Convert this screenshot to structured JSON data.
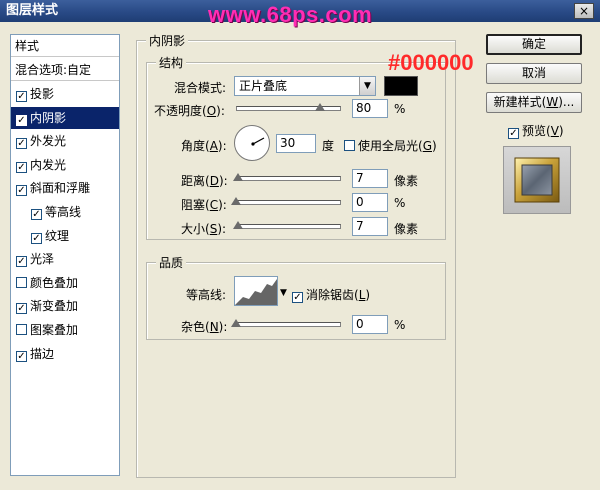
{
  "window": {
    "title": "图层样式",
    "close_label": "×"
  },
  "overlay": {
    "watermark": "www.68ps.com",
    "hex_annotation": "#000000"
  },
  "sidebar": {
    "header": "样式",
    "blend_options": "混合选项:自定",
    "items": [
      {
        "label": "投影",
        "checked": true,
        "selected": false,
        "indent": false
      },
      {
        "label": "内阴影",
        "checked": true,
        "selected": true,
        "indent": false
      },
      {
        "label": "外发光",
        "checked": true,
        "selected": false,
        "indent": false
      },
      {
        "label": "内发光",
        "checked": true,
        "selected": false,
        "indent": false
      },
      {
        "label": "斜面和浮雕",
        "checked": true,
        "selected": false,
        "indent": false
      },
      {
        "label": "等高线",
        "checked": true,
        "selected": false,
        "indent": true
      },
      {
        "label": "纹理",
        "checked": true,
        "selected": false,
        "indent": true
      },
      {
        "label": "光泽",
        "checked": true,
        "selected": false,
        "indent": false
      },
      {
        "label": "颜色叠加",
        "checked": false,
        "selected": false,
        "indent": false
      },
      {
        "label": "渐变叠加",
        "checked": true,
        "selected": false,
        "indent": false
      },
      {
        "label": "图案叠加",
        "checked": false,
        "selected": false,
        "indent": false
      },
      {
        "label": "描边",
        "checked": true,
        "selected": false,
        "indent": false
      }
    ]
  },
  "inner_shadow": {
    "panel_title": "内阴影",
    "structure": {
      "title": "结构",
      "blend_mode_label_pre": "混合模式:",
      "blend_mode_value": "正片叠底",
      "color": "#000000",
      "opacity_label_pre": "不透明度(",
      "opacity_key": "O",
      "opacity_label_post": "):",
      "opacity_value": "80",
      "opacity_unit": "%",
      "opacity_level": 0.8,
      "angle_label_pre": "角度(",
      "angle_key": "A",
      "angle_label_post": "):",
      "angle_value": "30",
      "angle_unit": "度",
      "global_light_label_pre": "使用全局光(",
      "global_light_key": "G",
      "global_light_label_post": ")",
      "global_light_checked": false,
      "distance_label_pre": "距离(",
      "distance_key": "D",
      "distance_label_post": "):",
      "distance_value": "7",
      "distance_unit": "像素",
      "distance_level": 0.02,
      "choke_label_pre": "阻塞(",
      "choke_key": "C",
      "choke_label_post": "):",
      "choke_value": "0",
      "choke_unit": "%",
      "choke_level": 0,
      "size_label_pre": "大小(",
      "size_key": "S",
      "size_label_post": "):",
      "size_value": "7",
      "size_unit": "像素",
      "size_level": 0.02
    },
    "quality": {
      "title": "品质",
      "contour_label": "等高线:",
      "antialias_label_pre": "消除锯齿(",
      "antialias_key": "L",
      "antialias_label_post": ")",
      "antialias_checked": true,
      "noise_label_pre": "杂色(",
      "noise_key": "N",
      "noise_label_post": "):",
      "noise_value": "0",
      "noise_unit": "%",
      "noise_level": 0
    }
  },
  "buttons": {
    "ok": "确定",
    "cancel": "取消",
    "new_style_pre": "新建样式(",
    "new_style_key": "W",
    "new_style_post": ")...",
    "preview_pre": "预览(",
    "preview_key": "V",
    "preview_post": ")",
    "preview_checked": true
  },
  "colors": {
    "titlebar": "#294a86",
    "selected_item": "#0a246a",
    "watermark": "#ff2db4",
    "annotation": "#ff2a2a"
  }
}
